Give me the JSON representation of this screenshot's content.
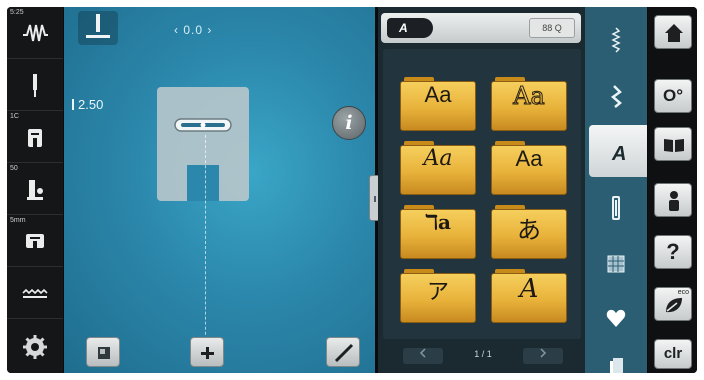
{
  "left_panel": {
    "stitch_number_label": "5:25",
    "presser_foot_label": "1C",
    "tension_label": "50",
    "stitch_width_label": "5mm"
  },
  "stitch_editor": {
    "needle_offset_value": "‹ 0.0 ›",
    "stitch_length_value": "2.50"
  },
  "alphabet_panel": {
    "category_label": "A",
    "search_label": "88 Q",
    "fonts": [
      "Aa",
      "Aa",
      "Aa",
      "Aa",
      "ℸa",
      "あ",
      "ア",
      "A"
    ],
    "page_indicator": "1 / 1"
  },
  "sidebar_right": {
    "clear_label": "clr",
    "eco_label": "eco",
    "help_label": "?",
    "thread_label": "O°"
  },
  "colors": {
    "accent": "#2b87ab",
    "folder": "#e8b23a",
    "category_column": "#2b5e73"
  }
}
